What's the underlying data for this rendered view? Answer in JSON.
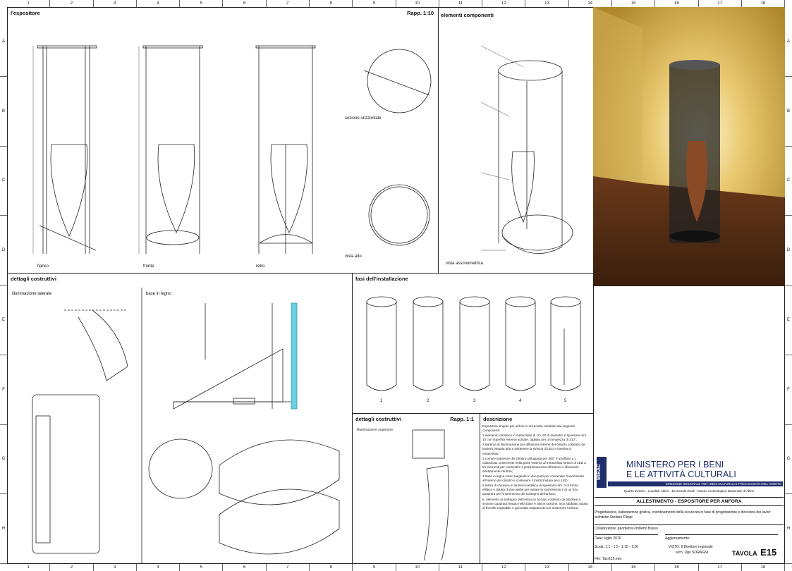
{
  "ruler": {
    "columns": [
      "1",
      "2",
      "3",
      "4",
      "5",
      "6",
      "7",
      "8",
      "9",
      "10",
      "11",
      "12",
      "13",
      "14",
      "15",
      "16",
      "17",
      "18"
    ],
    "rows": [
      "A",
      "B",
      "C",
      "D",
      "E",
      "F",
      "G",
      "H"
    ]
  },
  "panels": {
    "espositore": {
      "title": "l'espositore",
      "scale": "Rapp. 1:10",
      "views": [
        "fianco",
        "fronte",
        "retro"
      ],
      "extra": [
        "sezione orizzontale",
        "vista alto"
      ]
    },
    "componenti": {
      "title": "elementi componenti",
      "caption": "vista assonometrica"
    },
    "dettagli": {
      "title": "dettagli costruttivi",
      "sub1": "illuminazione laterale",
      "sub2": "base in legno"
    },
    "fasi": {
      "title": "fasi dell'installazione",
      "steps": [
        "1",
        "2",
        "3",
        "4",
        "5"
      ]
    },
    "dettagli2": {
      "title": "dettagli costruttivi",
      "scale": "Rapp. 1:1",
      "sub": "illuminazione superiore"
    },
    "descrizione": {
      "title": "descrizione",
      "paragraphs": [
        "Espositore singolo per anfore in terracotta costituito dai seguenti componenti:",
        "1.elemento cilindrico in metacrilato di cm. 60 di diametro e spessore mm. 10 con superfici esterne acidate, tagliato per un'ampiezza di 210°;",
        "2.sistema di illuminazione per diffusione interna del cilindro costituito da lamiera piegata atta a sostenere la striscia di LED e inserita al metacrilato;",
        "3.cornice superiore del cilindro sviluppata per 360° in profilato a L calandrato contenente nella parte esterna al metacrilato strisce di LED a tre elementi per consentire il posizionamento all'interno e illuminare direttamente l'anfora;",
        "4.base in legno rosso tangente in due parti per consentire l'inserimento all'interno del cilindro e contenere il trasformatore per i LED;",
        "5.lastra di chiusura in lamiera metallica di spessore mm. 3 di forma ellittica e dotata di due alette per evitare lo scorrimento e di un foro quadrato per l'inserimento del sostegno dell'anfora;",
        "6. elemento di sostegno dell'anfora in acciaio costituito da tubolare a sezione quadrata fissato nella base e alla in sezione, inox sabbiato dotato di forcella regolabile e gommata trasparente per sostenere l'anfora."
      ]
    }
  },
  "title_block": {
    "logo": "MiBAC",
    "ministry1": "MINISTERO PER I BENI",
    "ministry2": "E LE ATTIVITÀ CULTURALI",
    "direzione": "DIREZIONE REGIONALE PER I BENI CULTURALI E PAESAGGISTICI DEL VENETO",
    "location": "Quarto d'Altino - Località: Altino - Ex Scuola Reali - Museo Archeologico Nazionale di Altino",
    "project": "ALLESTIMENTO - ESPOSITORE PER ANFORA",
    "credits": "Progettazione, elaborazione grafica, coordinamento della sicurezza in fase di progettazione e direzione dei lavori: architetto Stefano Filippi",
    "collaboratore": "Collaboratore: geometra Umberto Basso",
    "data": "Data: luglio 2010",
    "aggiornamento": "Aggiornamento:",
    "scala": "Scala: 1:1 - 1:5 - 1:10 - 1:20",
    "visto": "VISTO: Il Direttore regionale",
    "direttore": "arch. Ugo SORAGNI",
    "file": "File: Tav.E15.vwx",
    "tavola_label": "TAVOLA",
    "tavola_num": "E15"
  },
  "colors": {
    "render_bg": "#c9a54a",
    "cyan_detail": "#6ad0e0",
    "navy": "#1f2d6b"
  }
}
